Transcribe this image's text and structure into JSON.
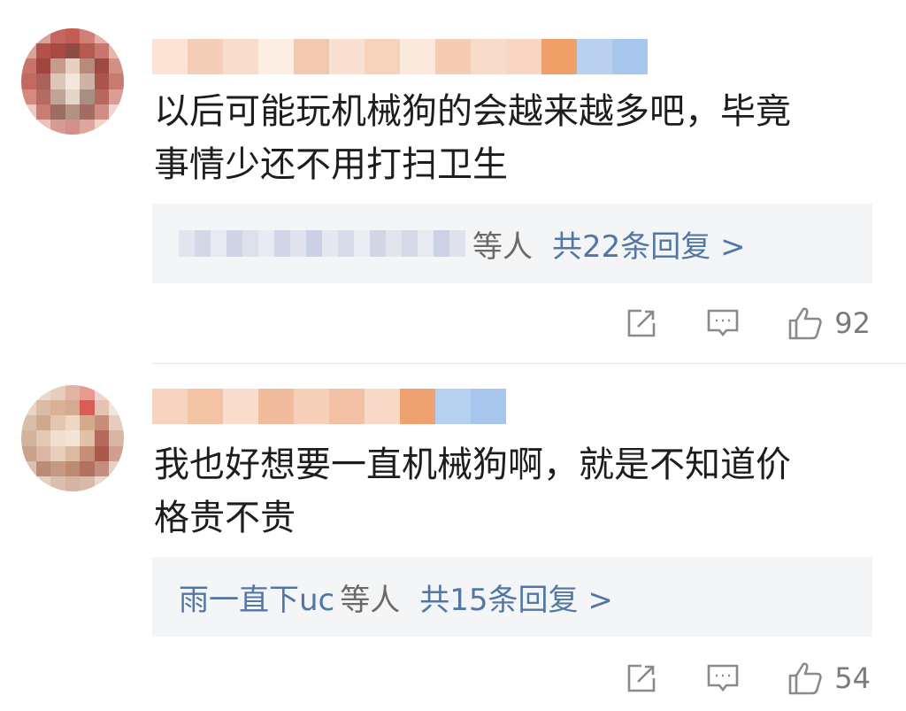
{
  "comments": [
    {
      "text_line1": "以后可能玩机械狗的会越来越多吧，毕竟",
      "text_line2": "事情少还不用打扫卫生",
      "reply_names": "",
      "reply_suffix": "等人",
      "reply_total": "共22条回复 >",
      "like_count": "92"
    },
    {
      "text_line1": "我也好想要一直机械狗啊，就是不知道价",
      "text_line2": "格贵不贵",
      "reply_names": "雨一直下uc",
      "reply_suffix": "等人",
      "reply_total": "共15条回复 >",
      "like_count": "54"
    }
  ],
  "icons": {
    "share": "share-icon",
    "comment": "comment-icon",
    "like": "thumbs-up-icon"
  },
  "colors": {
    "link": "#5277a6",
    "text": "#1d1d1d",
    "reply_bg": "#f4f5f7",
    "icon": "#8a8a8a"
  }
}
